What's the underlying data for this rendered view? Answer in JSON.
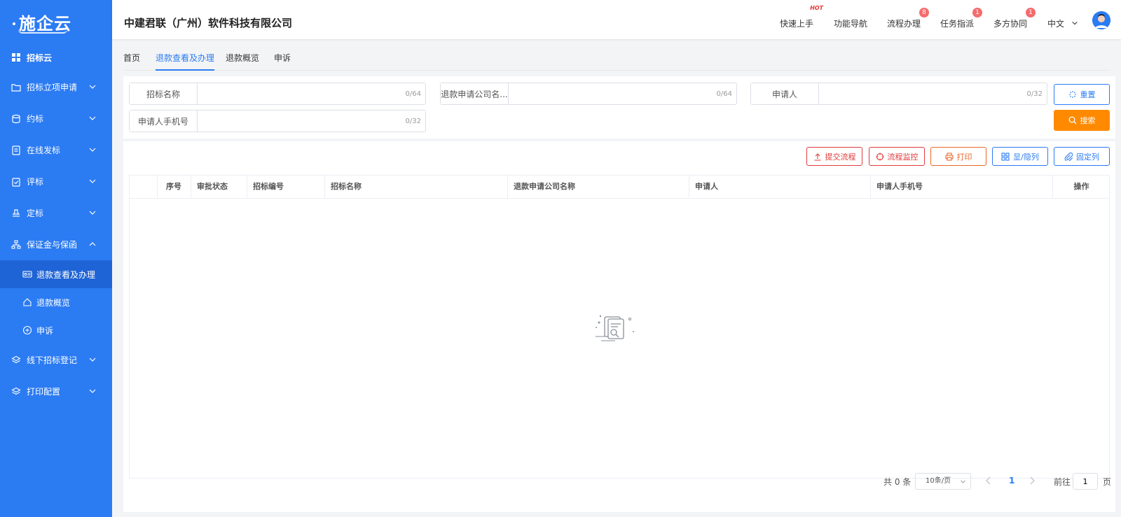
{
  "brand": {
    "logo_text": "施企云"
  },
  "sidebar": {
    "items": [
      {
        "label": "招标云"
      },
      {
        "label": "招标立项申请"
      },
      {
        "label": "约标"
      },
      {
        "label": "在线发标"
      },
      {
        "label": "评标"
      },
      {
        "label": "定标"
      },
      {
        "label": "保证金与保函"
      },
      {
        "label": "线下招标登记"
      },
      {
        "label": "打印配置"
      }
    ],
    "subitems": [
      {
        "label": "退款查看及办理"
      },
      {
        "label": "退款概览"
      },
      {
        "label": "申诉"
      }
    ]
  },
  "header": {
    "company": "中建君联（广州）软件科技有限公司",
    "nav": [
      {
        "label": "快速上手",
        "tag": "HOT"
      },
      {
        "label": "功能导航"
      },
      {
        "label": "流程办理",
        "badge": "8"
      },
      {
        "label": "任务指派",
        "badge": "1"
      },
      {
        "label": "多方协同",
        "badge": "1"
      }
    ],
    "language": "中文"
  },
  "tabs": [
    {
      "label": "首页"
    },
    {
      "label": "退款查看及办理"
    },
    {
      "label": "退款概览"
    },
    {
      "label": "申诉"
    }
  ],
  "search": {
    "fields": [
      {
        "label": "招标名称",
        "value": "",
        "counter": "0/64"
      },
      {
        "label": "退款申请公司名...",
        "value": "",
        "counter": "0/64"
      },
      {
        "label": "申请人",
        "value": "",
        "counter": "0/32"
      },
      {
        "label": "申请人手机号",
        "value": "",
        "counter": "0/32"
      }
    ],
    "reset_label": "重置",
    "search_label": "搜索"
  },
  "toolbar": {
    "submit_label": "提交流程",
    "monitor_label": "流程监控",
    "print_label": "打印",
    "toggle_cols_label": "显/隐列",
    "fix_cols_label": "固定列"
  },
  "table": {
    "columns": [
      "序号",
      "审批状态",
      "招标编号",
      "招标名称",
      "退款申请公司名称",
      "申请人",
      "申请人手机号",
      "操作"
    ]
  },
  "pagination": {
    "total": "共 0 条",
    "page_size": "10条/页",
    "current_page": "1",
    "goto_prefix": "前往",
    "goto_value": "1",
    "goto_suffix": "页"
  },
  "colors": {
    "primary": "#2b7bf3",
    "search": "#ff8a00",
    "danger": "#e03c3c",
    "badge": "#f56c6c"
  }
}
